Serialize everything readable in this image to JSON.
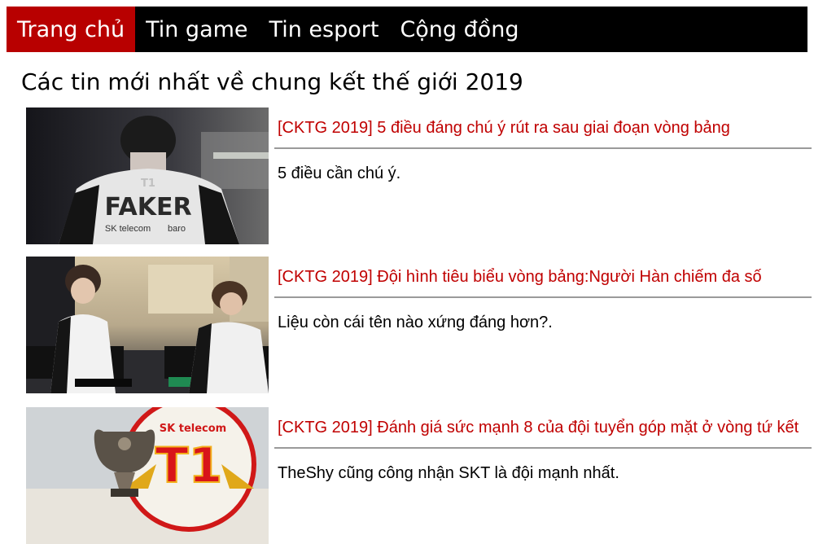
{
  "nav": {
    "items": [
      {
        "label": "Trang chủ",
        "active": true
      },
      {
        "label": "Tin game",
        "active": false
      },
      {
        "label": "Tin esport",
        "active": false
      },
      {
        "label": "Cộng đồng",
        "active": false
      }
    ]
  },
  "page_title": "Các tin mới nhất về chung kết thế giới 2019",
  "articles": [
    {
      "title": "[CKTG 2019] 5 điều đáng chú ý rút ra sau giai đoạn vòng bảng",
      "summary": "5 điều cần chú ý.",
      "image": {
        "jersey_name": "FAKER",
        "team_logo": "T1",
        "sponsor": "SK telecom",
        "sponsor2": "baro"
      }
    },
    {
      "title": "[CKTG 2019] Đội hình tiêu biểu vòng bảng:Người Hàn chiếm đa số",
      "summary": "Liệu còn cái tên nào xứng đáng hơn?.",
      "image": {}
    },
    {
      "title": "[CKTG 2019] Đánh giá sức mạnh 8 của đội tuyển góp mặt ở vòng tứ kết",
      "summary": "TheShy cũng công nhận SKT là đội mạnh nhất.",
      "image": {
        "banner_text": "SK telecom",
        "logo": "T1"
      }
    }
  ],
  "colors": {
    "nav_bg": "#000000",
    "nav_active": "#b80000",
    "headline": "#c00000",
    "rule": "#9a9a9a"
  }
}
